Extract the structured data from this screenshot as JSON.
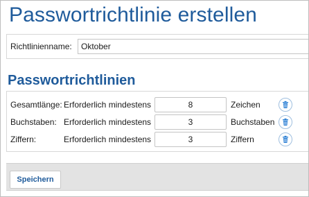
{
  "page": {
    "title": "Passwortrichtlinie erstellen"
  },
  "policy_name": {
    "label": "Richtlinienname:",
    "value": "Oktober"
  },
  "rules_section": {
    "title": "Passwortrichtlinien",
    "rules": [
      {
        "label": "Gesamtlänge:",
        "requirement": "Erforderlich mindestens",
        "value": "8",
        "unit": "Zeichen",
        "delete_icon": "trash-icon"
      },
      {
        "label": "Buchstaben:",
        "requirement": "Erforderlich mindestens",
        "value": "3",
        "unit": "Buchstaben",
        "delete_icon": "trash-icon"
      },
      {
        "label": "Ziffern:",
        "requirement": "Erforderlich mindestens",
        "value": "3",
        "unit": "Ziffern",
        "delete_icon": "trash-icon"
      }
    ]
  },
  "footer": {
    "save_label": "Speichern"
  },
  "colors": {
    "accent": "#1f5b9b",
    "delete_icon": "#2a7fd4",
    "footer_bg": "#e3e3e3"
  }
}
